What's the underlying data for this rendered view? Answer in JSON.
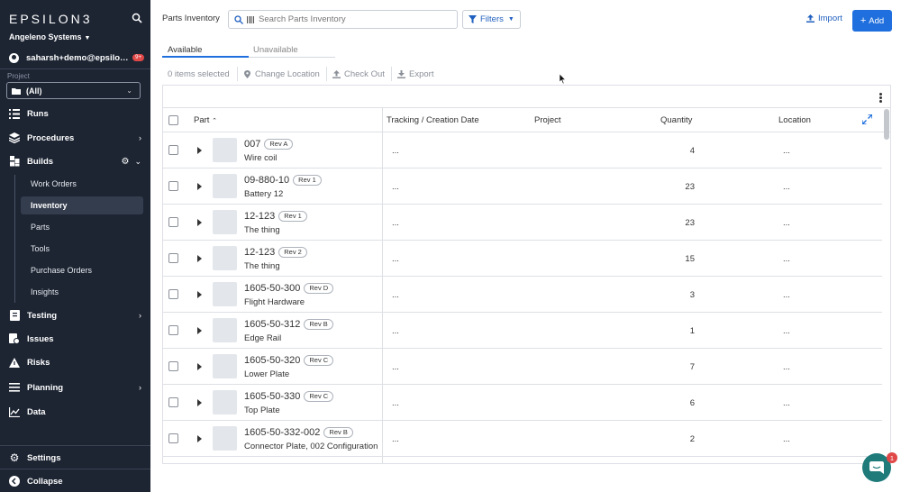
{
  "sidebar": {
    "logo": "EPSILON3",
    "org": "Angeleno Systems",
    "user_email": "saharsh+demo@epsilo…",
    "user_badge": "9+",
    "project_label": "Project",
    "project_value": "(All)",
    "nav": [
      {
        "label": "Runs",
        "icon": "runs-icon"
      },
      {
        "label": "Procedures",
        "icon": "procedures-icon"
      },
      {
        "label": "Builds",
        "icon": "builds-icon"
      },
      {
        "label": "Testing",
        "icon": "testing-icon"
      },
      {
        "label": "Issues",
        "icon": "issues-icon"
      },
      {
        "label": "Risks",
        "icon": "risks-icon"
      },
      {
        "label": "Planning",
        "icon": "planning-icon"
      },
      {
        "label": "Data",
        "icon": "data-icon"
      }
    ],
    "builds_sub": [
      "Work Orders",
      "Inventory",
      "Parts",
      "Tools",
      "Purchase Orders",
      "Insights"
    ],
    "settings": "Settings",
    "collapse": "Collapse"
  },
  "header": {
    "title": "Parts Inventory",
    "search_placeholder": "Search Parts Inventory",
    "filters": "Filters",
    "import": "Import",
    "add": "Add"
  },
  "tabs": {
    "available": "Available",
    "unavailable": "Unavailable"
  },
  "toolbar": {
    "selected": "0 items selected",
    "change_location": "Change Location",
    "check_out": "Check Out",
    "export": "Export"
  },
  "table": {
    "headers": {
      "part": "Part",
      "tracking": "Tracking / Creation Date",
      "project": "Project",
      "quantity": "Quantity",
      "location": "Location"
    },
    "rows": [
      {
        "part": "007",
        "rev": "Rev A",
        "name": "Wire coil",
        "tracking": "...",
        "qty": "4",
        "location": "..."
      },
      {
        "part": "09-880-10",
        "rev": "Rev 1",
        "name": "Battery 12",
        "tracking": "...",
        "qty": "23",
        "location": "..."
      },
      {
        "part": "12-123",
        "rev": "Rev 1",
        "name": "The thing",
        "tracking": "...",
        "qty": "23",
        "location": "..."
      },
      {
        "part": "12-123",
        "rev": "Rev 2",
        "name": "The thing",
        "tracking": "...",
        "qty": "15",
        "location": "..."
      },
      {
        "part": "1605-50-300",
        "rev": "Rev D",
        "name": "Flight Hardware",
        "tracking": "...",
        "qty": "3",
        "location": "..."
      },
      {
        "part": "1605-50-312",
        "rev": "Rev B",
        "name": "Edge Rail",
        "tracking": "...",
        "qty": "1",
        "location": "..."
      },
      {
        "part": "1605-50-320",
        "rev": "Rev C",
        "name": "Lower Plate",
        "tracking": "...",
        "qty": "7",
        "location": "..."
      },
      {
        "part": "1605-50-330",
        "rev": "Rev C",
        "name": "Top Plate",
        "tracking": "...",
        "qty": "6",
        "location": "..."
      },
      {
        "part": "1605-50-332-002",
        "rev": "Rev B",
        "name": "Connector Plate, 002 Configuration",
        "tracking": "...",
        "qty": "2",
        "location": "..."
      }
    ]
  },
  "chat_badge": "1",
  "colors": {
    "sidebar_bg": "#1d2533",
    "accent": "#1f6fde",
    "badge": "#e04848"
  }
}
